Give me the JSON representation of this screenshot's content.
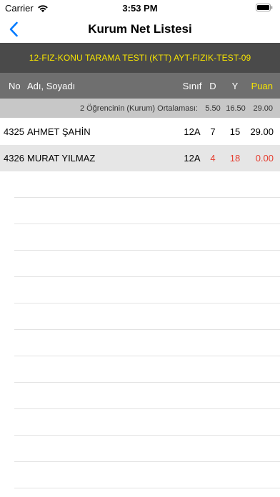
{
  "status_bar": {
    "carrier": "Carrier",
    "time": "3:53 PM"
  },
  "nav": {
    "title": "Kurum Net Listesi"
  },
  "exam": {
    "title": "12-FIZ-KONU TARAMA TESTI (KTT) AYT-FIZIK-TEST-09"
  },
  "table": {
    "headers": {
      "no": "No",
      "name": "Adı, Soyadı",
      "class": "Sınıf",
      "d": "D",
      "y": "Y",
      "puan": "Puan"
    },
    "summary": {
      "label": "2 Öğrencinin (Kurum) Ortalaması:",
      "d": "5.50",
      "y": "16.50",
      "puan": "29.00"
    },
    "rows": [
      {
        "no": "4325",
        "name": "AHMET ŞAHİN",
        "class": "12A",
        "d": "7",
        "y": "15",
        "puan": "29.00"
      },
      {
        "no": "4326",
        "name": "MURAT YILMAZ",
        "class": "12A",
        "d": "4",
        "y": "18",
        "puan": "0.00"
      }
    ]
  },
  "colors": {
    "accent": "#007aff",
    "banner_text": "#f6e400",
    "warning": "#e53d2f"
  }
}
